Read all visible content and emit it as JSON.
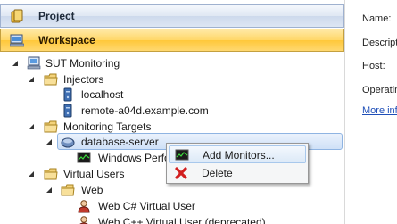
{
  "header": {
    "project_label": "Project",
    "workspace_label": "Workspace"
  },
  "tree": {
    "root": "SUT Monitoring",
    "injectors": "Injectors",
    "localhost": "localhost",
    "remote": "remote-a04d.example.com",
    "monitoring_targets": "Monitoring Targets",
    "database_server": "database-server",
    "windows_perf": "Windows Perfo",
    "virtual_users": "Virtual Users",
    "web": "Web",
    "vu_csharp": "Web C# Virtual User",
    "vu_cpp": "Web C++ Virtual User (deprecated)"
  },
  "context_menu": {
    "add_monitors": "Add Monitors...",
    "delete": "Delete"
  },
  "details": {
    "name_label": "Name:",
    "description_label": "Descript",
    "host_label": "Host:",
    "operating_label": "Operatin",
    "more_info_link": "More inf"
  },
  "colors": {
    "workspace_header": "#ffd04f",
    "project_header": "#dfe7f3",
    "selection": "#cfe1f7",
    "link": "#1f4fb8"
  }
}
